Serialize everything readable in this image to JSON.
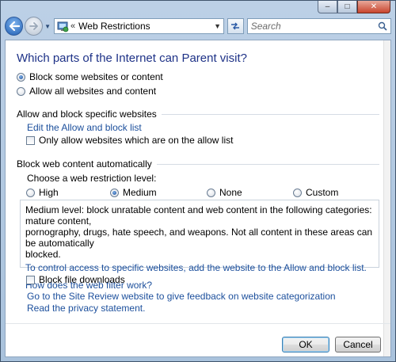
{
  "window": {
    "controls": {
      "minimize": "–",
      "maximize": "□",
      "close": "✕"
    }
  },
  "navbar": {
    "address_separator": "«",
    "address_text": "Web Restrictions",
    "search_placeholder": "Search"
  },
  "page": {
    "title": "Which parts of the Internet can Parent visit?",
    "access_options": [
      {
        "label": "Block some websites or content",
        "selected": true
      },
      {
        "label": "Allow all websites and content",
        "selected": false
      }
    ]
  },
  "allow_block": {
    "header": "Allow and block specific websites",
    "edit_link": "Edit the Allow and block list",
    "only_allow_label": "Only allow websites which are on the allow list",
    "only_allow_checked": false
  },
  "auto_block": {
    "header": "Block web content automatically",
    "choose_label": "Choose a web restriction level:",
    "levels": [
      {
        "label": "High",
        "selected": false
      },
      {
        "label": "Medium",
        "selected": true
      },
      {
        "label": "None",
        "selected": false
      },
      {
        "label": "Custom",
        "selected": false
      }
    ],
    "description_line1": "Medium level:  block unratable content and web content in the following categories:  mature content,",
    "description_line2": "pornography, drugs, hate speech, and weapons.  Not all content in these areas can be automatically",
    "description_line3": "blocked.",
    "control_access_link": "To control access to specific websites, add the website to the Allow and block list.",
    "filter_help_link": "How does the web filter work?"
  },
  "downloads": {
    "block_label": "Block file downloads",
    "block_checked": false
  },
  "links": {
    "site_review": "Go to the Site Review website to give feedback on website categorization",
    "privacy": "Read the privacy statement."
  },
  "buttons": {
    "ok": "OK",
    "cancel": "Cancel"
  }
}
